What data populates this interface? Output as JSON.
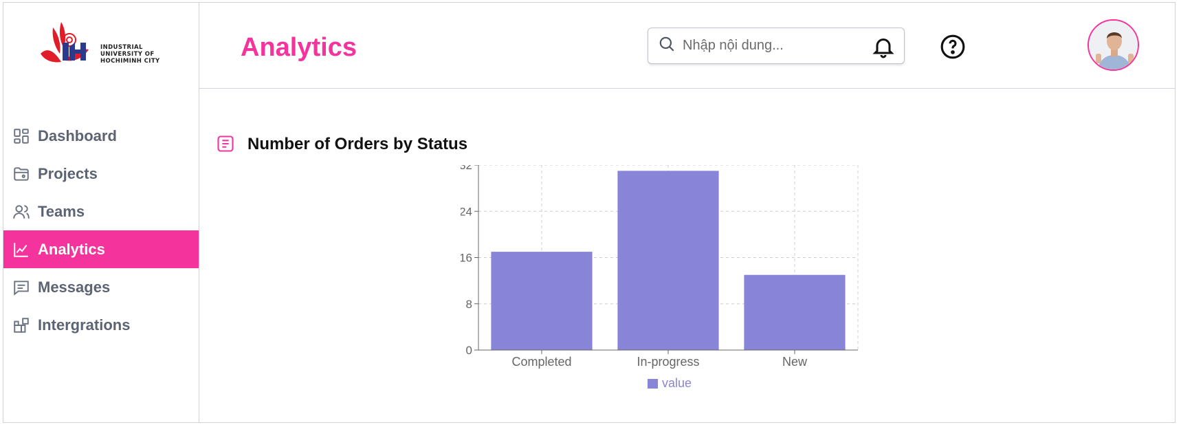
{
  "logo": {
    "text": "INDUSTRIAL\nUNIVERSITY OF\nHOCHIMINH CITY"
  },
  "sidebar": {
    "items": [
      {
        "label": "Dashboard",
        "icon": "dashboard-icon",
        "active": false
      },
      {
        "label": "Projects",
        "icon": "folder-icon",
        "active": false
      },
      {
        "label": "Teams",
        "icon": "users-icon",
        "active": false
      },
      {
        "label": "Analytics",
        "icon": "chart-line-icon",
        "active": true
      },
      {
        "label": "Messages",
        "icon": "message-icon",
        "active": false
      },
      {
        "label": "Intergrations",
        "icon": "integrations-icon",
        "active": false
      }
    ]
  },
  "header": {
    "title": "Analytics",
    "search_placeholder": "Nhập nội dung...",
    "icons": [
      "bell-icon",
      "help-icon",
      "avatar"
    ]
  },
  "section": {
    "title": "Number of Orders by Status"
  },
  "colors": {
    "accent": "#f4339d",
    "bar": "#8884d8",
    "sidebar_text": "#5c6474"
  },
  "chart_data": {
    "type": "bar",
    "categories": [
      "Completed",
      "In-progress",
      "New"
    ],
    "series": [
      {
        "name": "value",
        "values": [
          17,
          31,
          13
        ]
      }
    ],
    "yticks": [
      0,
      8,
      16,
      24,
      32
    ],
    "ylim": [
      0,
      32
    ],
    "grid": true,
    "legend": "bottom-center"
  }
}
